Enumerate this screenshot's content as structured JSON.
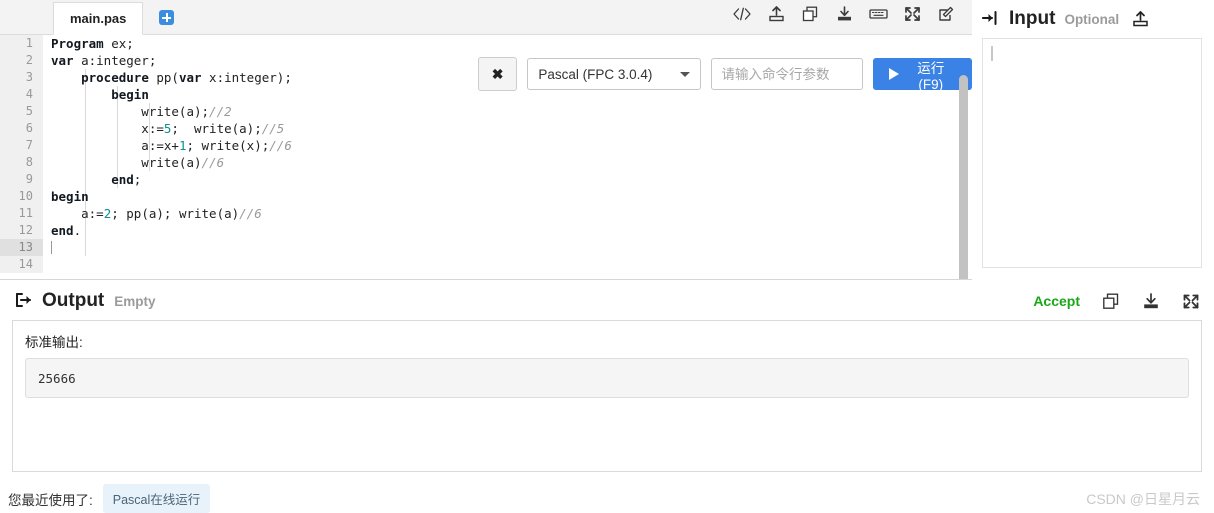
{
  "editor": {
    "tab": {
      "filename": "main.pas",
      "add_tab_icon": "plus-icon"
    },
    "toolbar_icons": [
      {
        "name": "code-icon",
        "label": "</>"
      },
      {
        "name": "upload-icon",
        "label": "upload"
      },
      {
        "name": "copy-icon",
        "label": "copy"
      },
      {
        "name": "download-icon",
        "label": "download"
      },
      {
        "name": "keyboard-icon",
        "label": "keyboard"
      },
      {
        "name": "fullscreen-icon",
        "label": "fullscreen"
      },
      {
        "name": "edit-icon",
        "label": "edit"
      }
    ],
    "lines": [
      {
        "n": "1",
        "code": "Program ex;"
      },
      {
        "n": "2",
        "code": "var a:integer;"
      },
      {
        "n": "3",
        "code": "    procedure pp(var x:integer);"
      },
      {
        "n": "4",
        "code": "        begin"
      },
      {
        "n": "5",
        "code": "            write(a);//2"
      },
      {
        "n": "6",
        "code": "            x:=5;  write(a);//5"
      },
      {
        "n": "7",
        "code": "            a:=x+1; write(x);//6"
      },
      {
        "n": "8",
        "code": "            write(a)//6"
      },
      {
        "n": "9",
        "code": "        end;"
      },
      {
        "n": "10",
        "code": "begin"
      },
      {
        "n": "11",
        "code": "    a:=2; pp(a); write(a)//6"
      },
      {
        "n": "12",
        "code": "end."
      },
      {
        "n": "13",
        "code": ""
      },
      {
        "n": "14",
        "code": ""
      }
    ]
  },
  "runbar": {
    "clear_label": "✖",
    "language": "Pascal (FPC 3.0.4)",
    "args_placeholder": "请输入命令行参数",
    "args_value": "",
    "run_label": "运行(F9)",
    "run_color": "#3b82e6"
  },
  "input_panel": {
    "title": "Input",
    "optional_label": "Optional",
    "upload_icon": "upload-icon",
    "value": ""
  },
  "output_panel": {
    "title": "Output",
    "status": "Empty",
    "accept_label": "Accept",
    "accept_color": "#18a818",
    "stdout_label": "标准输出:",
    "stdout_value": "25666",
    "actions": [
      {
        "name": "copy-icon"
      },
      {
        "name": "download-icon"
      },
      {
        "name": "fullscreen-icon"
      }
    ]
  },
  "footer": {
    "recent_label": "您最近使用了:",
    "recent_badge": "Pascal在线运行",
    "watermark": "CSDN @日星月云"
  }
}
